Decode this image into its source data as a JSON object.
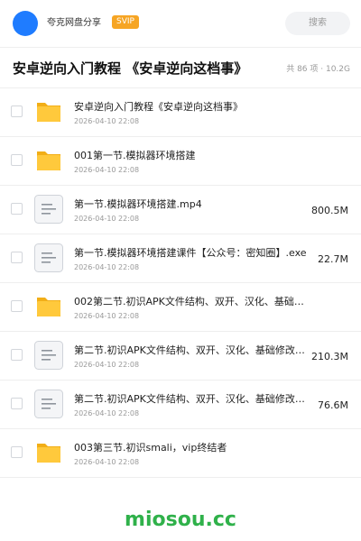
{
  "header": {
    "app_name": "夸克网盘分享",
    "badge": "SVIP",
    "search_label": "搜索"
  },
  "title_row": {
    "title": "安卓逆向入门教程 《安卓逆向这档事》",
    "summary": "共 86 项 · 10.2G"
  },
  "colors": {
    "accent": "#1f7cff",
    "badge": "#f6a524",
    "folder": "#ffc93c",
    "watermark": "#2fb14a"
  },
  "files": [
    {
      "type": "folder-icon",
      "name": "安卓逆向入门教程《安卓逆向这档事》",
      "date": "2026-04-10 22:08",
      "size": ""
    },
    {
      "type": "folder-icon",
      "name": "001第一节.模拟器环境搭建",
      "date": "2026-04-10 22:08",
      "size": ""
    },
    {
      "type": "file-icon",
      "name": "第一节.模拟器环境搭建.mp4",
      "date": "2026-04-10 22:08",
      "size": "800.5M"
    },
    {
      "type": "file-icon",
      "name": "第一节.模拟器环境搭建课件【公众号：密知圈】.exe",
      "date": "2026-04-10 22:08",
      "size": "22.7M"
    },
    {
      "type": "folder-icon",
      "name": "002第二节.初识APK文件结构、双开、汉化、基础…",
      "date": "2026-04-10 22:08",
      "size": ""
    },
    {
      "type": "file-icon",
      "name": "第二节.初识APK文件结构、双开、汉化、基础修改.…",
      "date": "2026-04-10 22:08",
      "size": "210.3M"
    },
    {
      "type": "file-icon",
      "name": "第二节.初识APK文件结构、双开、汉化、基础修改课…",
      "date": "2026-04-10 22:08",
      "size": "76.6M"
    },
    {
      "type": "folder-icon",
      "name": "003第三节.初识smali，vip终结者",
      "date": "2026-04-10 22:08",
      "size": ""
    }
  ],
  "watermark": "miosou.cc"
}
